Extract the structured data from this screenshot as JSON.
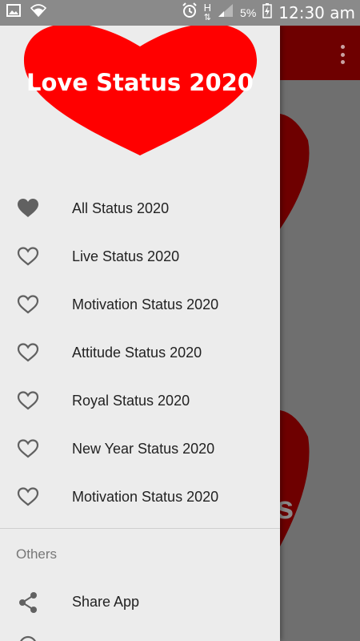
{
  "status_bar": {
    "battery_percent": "5%",
    "time": "12:30 am",
    "network": "H",
    "icons": [
      "gallery-icon",
      "wifi-icon",
      "alarm-icon",
      "network-h-icon",
      "signal-icon",
      "battery-charging-icon"
    ]
  },
  "background_app": {
    "appbar_color": "#6e0000",
    "overflow_icon": "more-vert-icon",
    "partial_text": "s"
  },
  "drawer": {
    "header": {
      "title": "Love Status 2020",
      "heart_color": "#ff0000"
    },
    "items": [
      {
        "label": "All Status 2020",
        "icon": "heart-filled-icon",
        "selected": true
      },
      {
        "label": "Live Status 2020",
        "icon": "heart-outline-icon"
      },
      {
        "label": "Motivation Status 2020",
        "icon": "heart-outline-icon"
      },
      {
        "label": "Attitude Status 2020",
        "icon": "heart-outline-icon"
      },
      {
        "label": "Royal Status 2020",
        "icon": "heart-outline-icon"
      },
      {
        "label": "New Year Status 2020",
        "icon": "heart-outline-icon"
      },
      {
        "label": "Motivation Status 2020",
        "icon": "heart-outline-icon"
      }
    ],
    "others_section": {
      "title": "Others",
      "share_label": "Share App",
      "share_icon": "share-icon"
    }
  }
}
